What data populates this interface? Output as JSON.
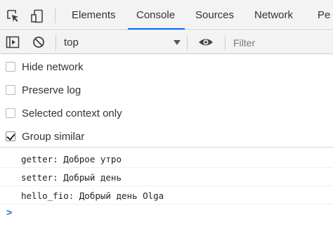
{
  "tabs": [
    {
      "label": "Elements"
    },
    {
      "label": "Console",
      "active": true
    },
    {
      "label": "Sources"
    },
    {
      "label": "Network"
    },
    {
      "label": "Pe"
    }
  ],
  "icons": {
    "inspect": "inspect-element-icon",
    "device": "device-toggle-icon",
    "sidebar": "console-sidebar-icon",
    "clear": "clear-console-icon",
    "eye": "live-expression-eye-icon",
    "dropdown": "chevron-down-icon",
    "prompt": "console-prompt-icon"
  },
  "toolbar": {
    "context": "top",
    "filter_placeholder": "Filter"
  },
  "settings": [
    {
      "label": "Hide network",
      "checked": false
    },
    {
      "label": "Preserve log",
      "checked": false
    },
    {
      "label": "Selected context only",
      "checked": false
    },
    {
      "label": "Group similar",
      "checked": true
    }
  ],
  "messages": [
    "getter: Доброе утро",
    "setter: Добрый день",
    "hello_fio: Добрый день Olga"
  ],
  "prompt_symbol": ">",
  "colors": {
    "accent": "#1a73e8",
    "toolbar_bg": "#f3f3f3"
  }
}
